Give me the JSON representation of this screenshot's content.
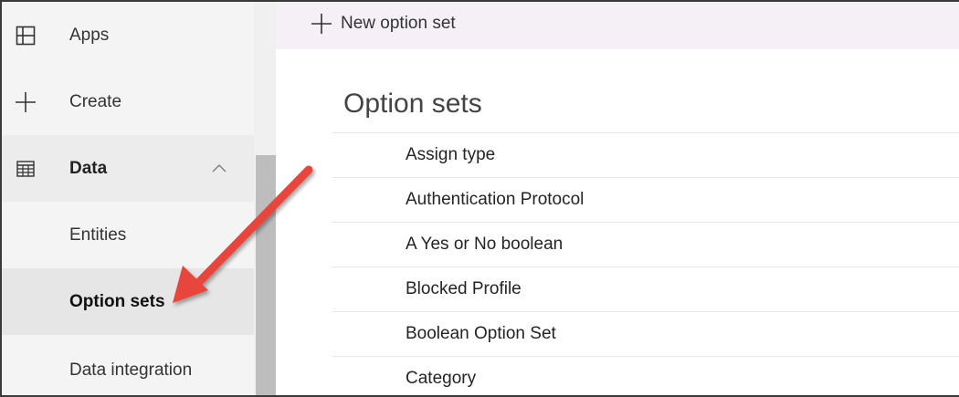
{
  "sidebar": {
    "items": [
      {
        "label": "Apps",
        "icon": "apps-icon"
      },
      {
        "label": "Create",
        "icon": "plus-icon"
      },
      {
        "label": "Data",
        "icon": "table-icon"
      },
      {
        "label": "Entities"
      },
      {
        "label": "Option sets"
      },
      {
        "label": "Data integration"
      }
    ],
    "selected": "Option sets"
  },
  "command_bar": {
    "new_label": "New option set"
  },
  "main": {
    "title": "Option sets",
    "rows": [
      "Assign type",
      "Authentication Protocol",
      "A Yes or No boolean",
      "Blocked Profile",
      "Boolean Option Set",
      "Category"
    ]
  },
  "annotation": {
    "arrow_color": "#e8453c"
  }
}
